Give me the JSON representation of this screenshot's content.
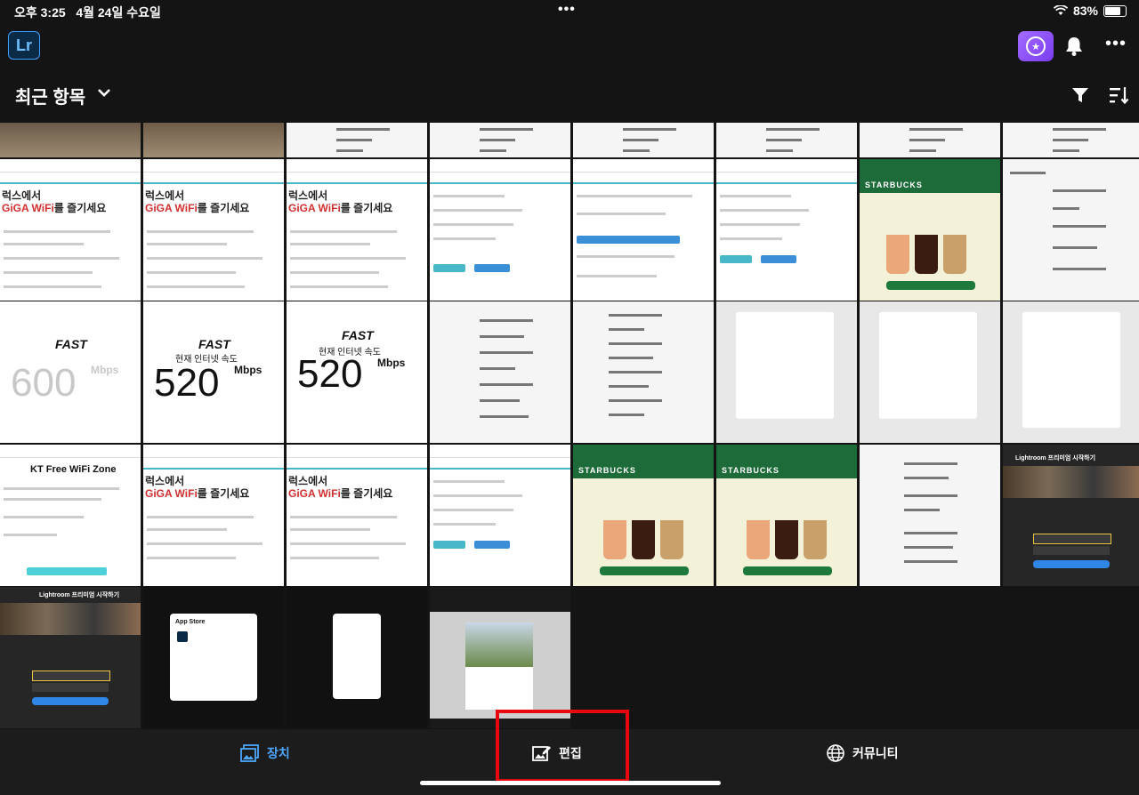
{
  "status": {
    "time": "오후 3:25",
    "date": "4월 24일 수요일",
    "battery": "83%",
    "battery_level": 0.83
  },
  "appbar": {
    "logo": "Lr",
    "icons": [
      "lr-logo",
      "premium-star-icon",
      "bell-icon",
      "more-icon"
    ]
  },
  "toolbar": {
    "album_title": "최근 항목",
    "icons": [
      "chevron-down-icon",
      "filter-icon",
      "sort-icon"
    ]
  },
  "tiles": {
    "kt_prefix": "럭스에서",
    "kt_giga": "GiGA WiFi",
    "kt_suffix": "를 즐기세요",
    "fast_logo": "FAST",
    "fast_speed_1": "600",
    "fast_speed_2": "520",
    "fast_unit": "Mbps",
    "fast_current": "현재 인터넷 속도",
    "starbucks": "STARBUCKS",
    "kt_free": "KT Free WiFi Zone",
    "lightroom_start": "Lightroom 프리미엄 시작하기",
    "app_store": "App Store"
  },
  "tabs": [
    {
      "label": "장치",
      "icon": "device-photos-icon",
      "active": true
    },
    {
      "label": "편집",
      "icon": "edit-image-icon",
      "active": false
    },
    {
      "label": "커뮤니티",
      "icon": "globe-icon",
      "active": false
    }
  ]
}
